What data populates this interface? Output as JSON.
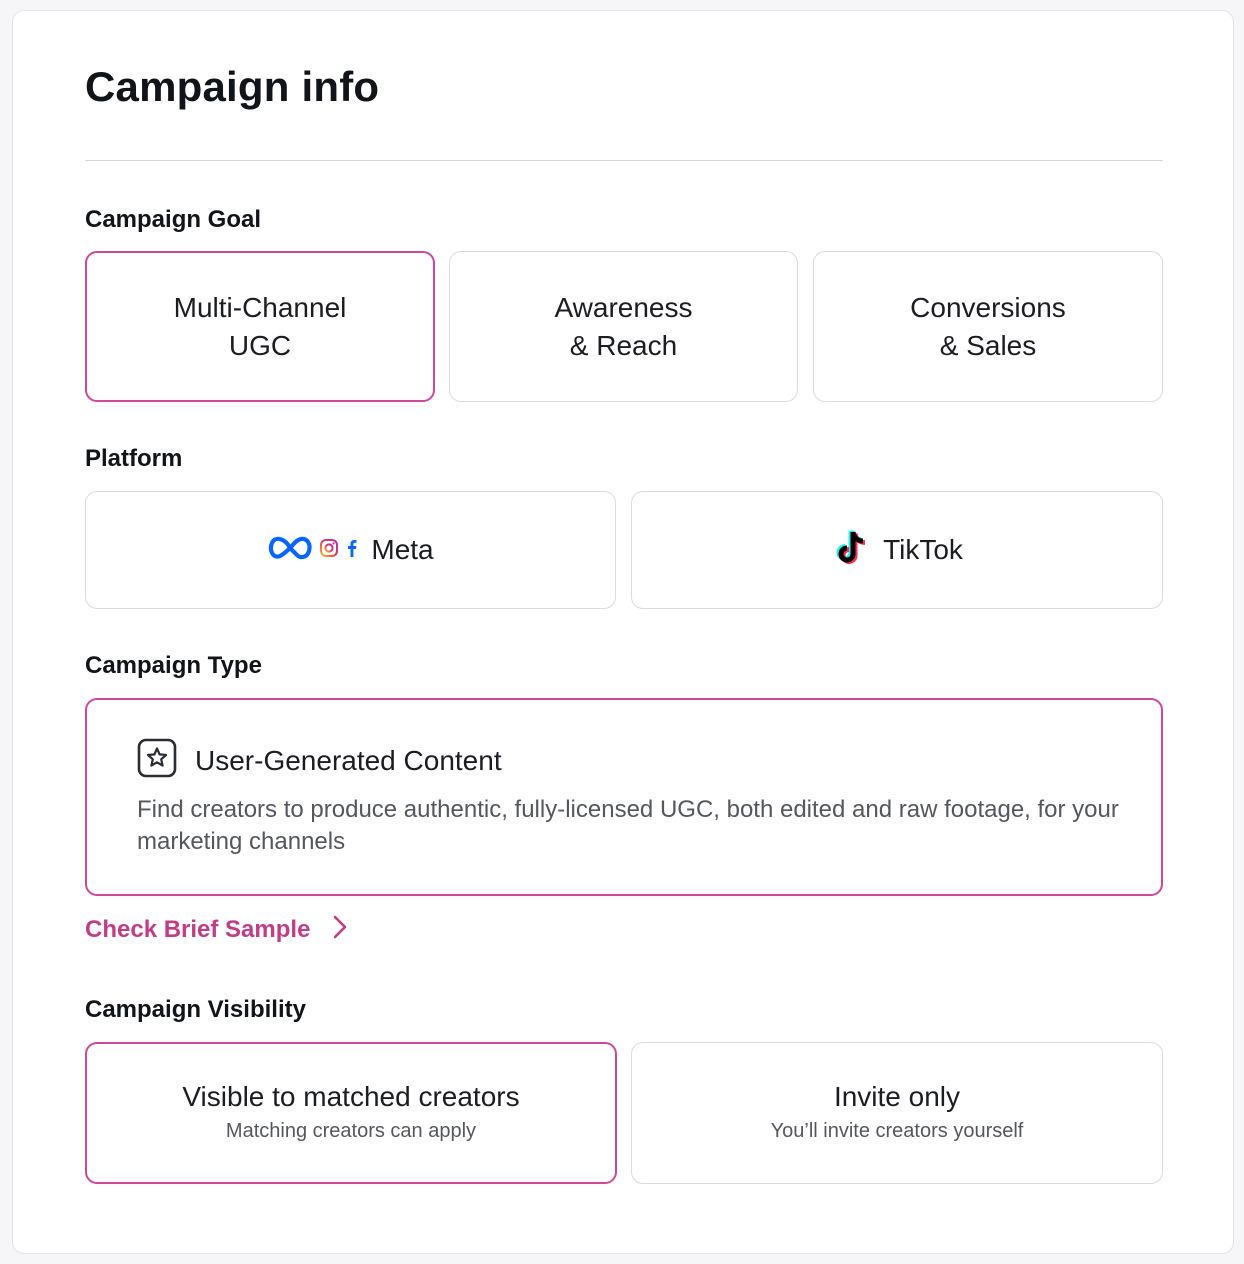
{
  "page": {
    "title": "Campaign info"
  },
  "goal": {
    "label": "Campaign Goal",
    "options": [
      {
        "line1": "Multi-Channel",
        "line2": "UGC",
        "selected": true
      },
      {
        "line1": "Awareness",
        "line2": "& Reach",
        "selected": false
      },
      {
        "line1": "Conversions",
        "line2": "& Sales",
        "selected": false
      }
    ]
  },
  "platform": {
    "label": "Platform",
    "options": [
      {
        "name": "Meta",
        "icons": [
          "meta-logo-icon",
          "instagram-icon",
          "facebook-icon"
        ]
      },
      {
        "name": "TikTok",
        "icons": [
          "tiktok-logo-icon"
        ]
      }
    ]
  },
  "type": {
    "label": "Campaign Type",
    "title": "User-Generated Content",
    "icon": "star-badge-icon",
    "description": "Find creators to produce authentic, fully-licensed UGC, both edited and raw footage, for your marketing channels"
  },
  "brief": {
    "link_label": "Check Brief Sample",
    "icon": "chevron-right-icon"
  },
  "visibility": {
    "label": "Campaign Visibility",
    "options": [
      {
        "title": "Visible to matched creators",
        "subtitle": "Matching creators can apply",
        "selected": true
      },
      {
        "title": "Invite only",
        "subtitle": "You’ll invite creators yourself",
        "selected": false
      }
    ]
  },
  "colors": {
    "accent": "#d0479a",
    "link": "#c23d87",
    "meta_blue": "#0866ff",
    "tiktok_cyan": "#25f4ee",
    "tiktok_red": "#fe2c55"
  }
}
